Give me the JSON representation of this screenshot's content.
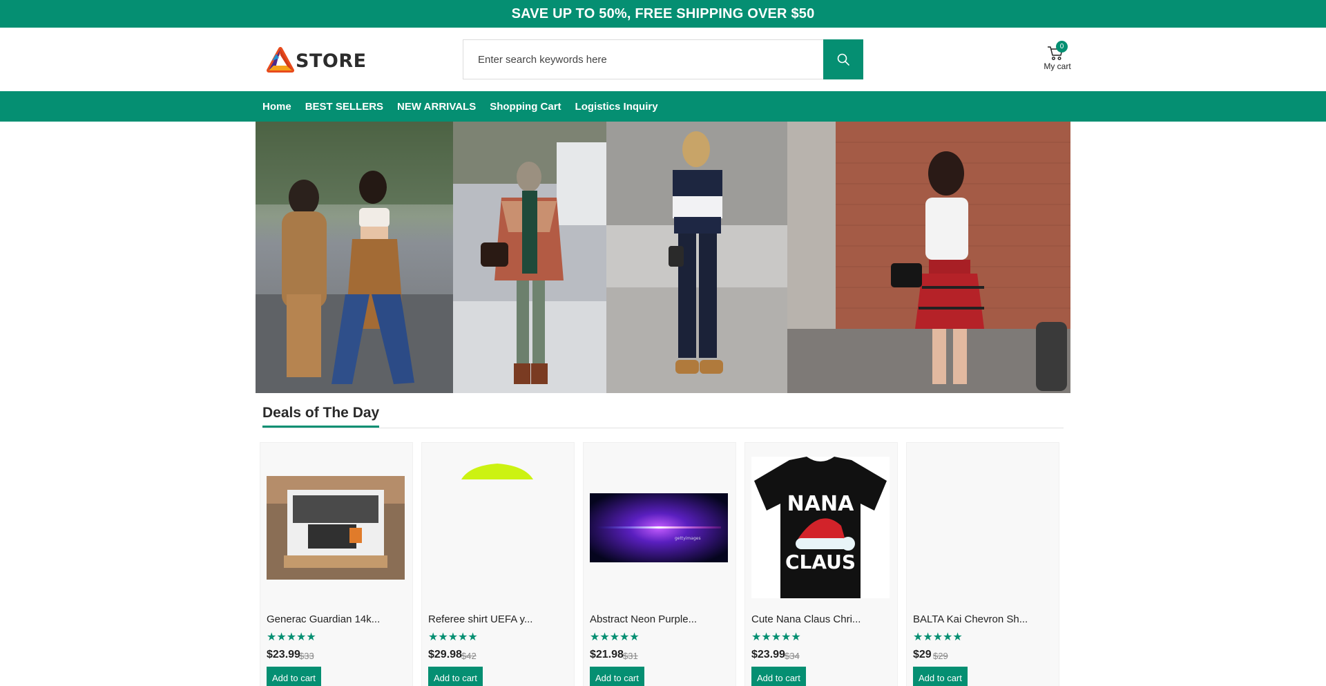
{
  "promo": {
    "text": "SAVE UP TO 50%, FREE SHIPPING OVER $50"
  },
  "header": {
    "logo_text": "STORE",
    "search": {
      "placeholder": "Enter search keywords here",
      "value": "",
      "button_icon": "search-icon"
    },
    "cart": {
      "count": "0",
      "label": "My cart",
      "icon": "cart-icon"
    }
  },
  "nav": {
    "items": [
      "Home",
      "BEST SELLERS",
      "NEW ARRIVALS",
      "Shopping Cart",
      "Logistics Inquiry"
    ]
  },
  "banner": {
    "panels": [
      "fashion-photo-1",
      "fashion-photo-2",
      "fashion-photo-3",
      "fashion-photo-4"
    ]
  },
  "deals": {
    "title": "Deals of The Day",
    "products": [
      {
        "name": "Generac Guardian 14k...",
        "stars": "★★★★★",
        "price": "$23.99",
        "old_price": "$33",
        "button": "Add to cart"
      },
      {
        "name": "Referee shirt UEFA y...",
        "stars": "★★★★★",
        "price": "$29.98",
        "old_price": "$42",
        "button": "Add to cart"
      },
      {
        "name": "Abstract Neon Purple...",
        "stars": "★★★★★",
        "price": "$21.98",
        "old_price": "$31",
        "button": "Add to cart"
      },
      {
        "name": "Cute Nana Claus Chri...",
        "stars": "★★★★★",
        "price": "$23.99",
        "old_price": "$34",
        "button": "Add to cart"
      },
      {
        "name": "BALTA Kai Chevron Sh...",
        "stars": "★★★★★",
        "price": "$29",
        "old_price": "$29",
        "button": "Add to cart"
      }
    ],
    "shirt_print": {
      "line1": "NANA",
      "line2": "CLAUS"
    },
    "neon_caption": "gettyimages"
  },
  "colors": {
    "brand": "#058f72",
    "star": "#058f72"
  }
}
